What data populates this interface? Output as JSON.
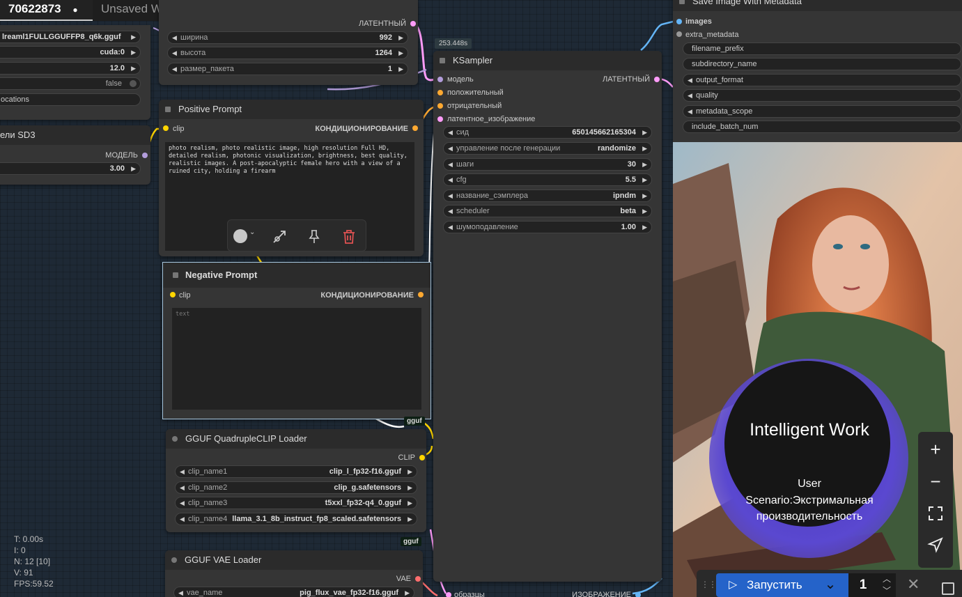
{
  "tabs": [
    {
      "label": "70622873",
      "dot": "●"
    },
    {
      "label": "Unsaved Workflow",
      "dot": "●"
    },
    {
      "label": "+"
    }
  ],
  "loader_node": {
    "w1": "lreaml1FULLGGUFFP8_q6k.gguf",
    "w2": "cuda:0",
    "w3": "12.0",
    "w4": "false",
    "w5": "ocations"
  },
  "sd3_node": {
    "title": "ели SD3",
    "out": "МОДЕЛЬ",
    "value": "3.00"
  },
  "latent_node": {
    "out": "ЛАТЕНТНЫЙ",
    "w": [
      {
        "label": "ширина",
        "value": "992"
      },
      {
        "label": "высота",
        "value": "1264"
      },
      {
        "label": "размер_пакета",
        "value": "1"
      }
    ]
  },
  "positive": {
    "title": "Positive Prompt",
    "in": "clip",
    "out": "КОНДИЦИОНИРОВАНИЕ",
    "text": "photo realism, photo realistic image, high resolution Full HD, detailed realism, photonic visualization, brightness, best quality, realistic images. A post-apocalyptic female hero with a view of a ruined city, holding a firearm"
  },
  "negative": {
    "title": "Negative Prompt",
    "in": "clip",
    "out": "КОНДИЦИОНИРОВАНИЕ",
    "placeholder": "text"
  },
  "gguf_badge": "gguf",
  "quadclip": {
    "title": "GGUF QuadrupleCLIP Loader",
    "out": "CLIP",
    "w": [
      {
        "label": "clip_name1",
        "value": "clip_l_fp32-f16.gguf"
      },
      {
        "label": "clip_name2",
        "value": "clip_g.safetensors"
      },
      {
        "label": "clip_name3",
        "value": "t5xxl_fp32-q4_0.gguf"
      },
      {
        "label": "clip_name4",
        "value": "llama_3.1_8b_instruct_fp8_scaled.safetensors"
      }
    ]
  },
  "vae": {
    "title": "GGUF VAE Loader",
    "out": "VAE",
    "w": {
      "label": "vae_name",
      "value": "pig_flux_vae_fp32-f16.gguf"
    }
  },
  "ksampler": {
    "time": "253.448s",
    "title": "KSampler",
    "in": [
      "модель",
      "положительный",
      "отрицательный",
      "латентное_изображение"
    ],
    "out": "ЛАТЕНТНЫЙ",
    "w": [
      {
        "label": "сид",
        "value": "650145662165304"
      },
      {
        "label": "управление после генерации",
        "value": "randomize"
      },
      {
        "label": "шаги",
        "value": "30"
      },
      {
        "label": "cfg",
        "value": "5.5"
      },
      {
        "label": "название_сэмплера",
        "value": "ipndm"
      },
      {
        "label": "scheduler",
        "value": "beta"
      },
      {
        "label": "шумоподавление",
        "value": "1.00"
      }
    ]
  },
  "decode": {
    "in": "образцы",
    "out": "ИЗОБРАЖЕНИЕ"
  },
  "save": {
    "title": "Save Image With Metadata",
    "in": [
      "images",
      "extra_metadata"
    ],
    "w": [
      "filename_prefix",
      "subdirectory_name",
      "output_format",
      "quality",
      "metadata_scope",
      "include_batch_num"
    ]
  },
  "overlay": {
    "title": "Intelligent Work",
    "line1": "User",
    "line2": "Scenario:Экстримальная",
    "line3": "производительность"
  },
  "stats": [
    "T: 0.00s",
    "I: 0",
    "N: 12 [10]",
    "V: 91",
    "FPS:59.52"
  ],
  "runbar": {
    "run": "Запустить",
    "count": "1"
  },
  "colors": {
    "clip": "#ffd500",
    "conditioning": "#ffa931",
    "latent": "#ff9cf9",
    "model": "#b39ddb",
    "image": "#64b5f6",
    "vae": "#ff6e6e",
    "trash": "#e05252"
  }
}
